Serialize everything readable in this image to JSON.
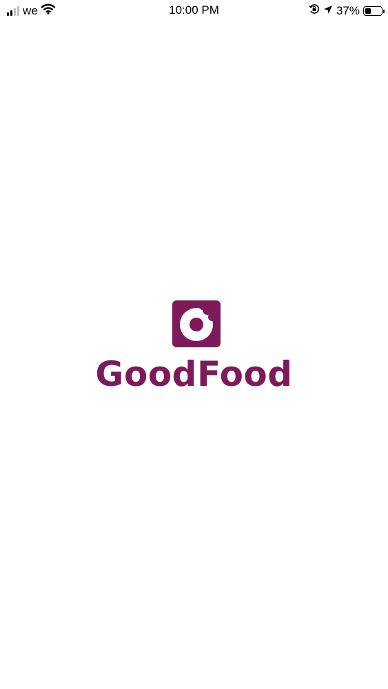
{
  "status_bar": {
    "carrier": "we",
    "time": "10:00 PM",
    "battery_percent": "37%",
    "battery_level": 0.37,
    "signal_bars_active": 2,
    "signal_bars_total": 4,
    "icons": [
      "signal-icon",
      "wifi-icon",
      "orientation-lock-icon",
      "location-icon",
      "battery-icon"
    ]
  },
  "splash": {
    "brand_name": "GoodFood",
    "brand_color": "#7d1a59",
    "logo_icon": "bitten-donut-icon"
  }
}
